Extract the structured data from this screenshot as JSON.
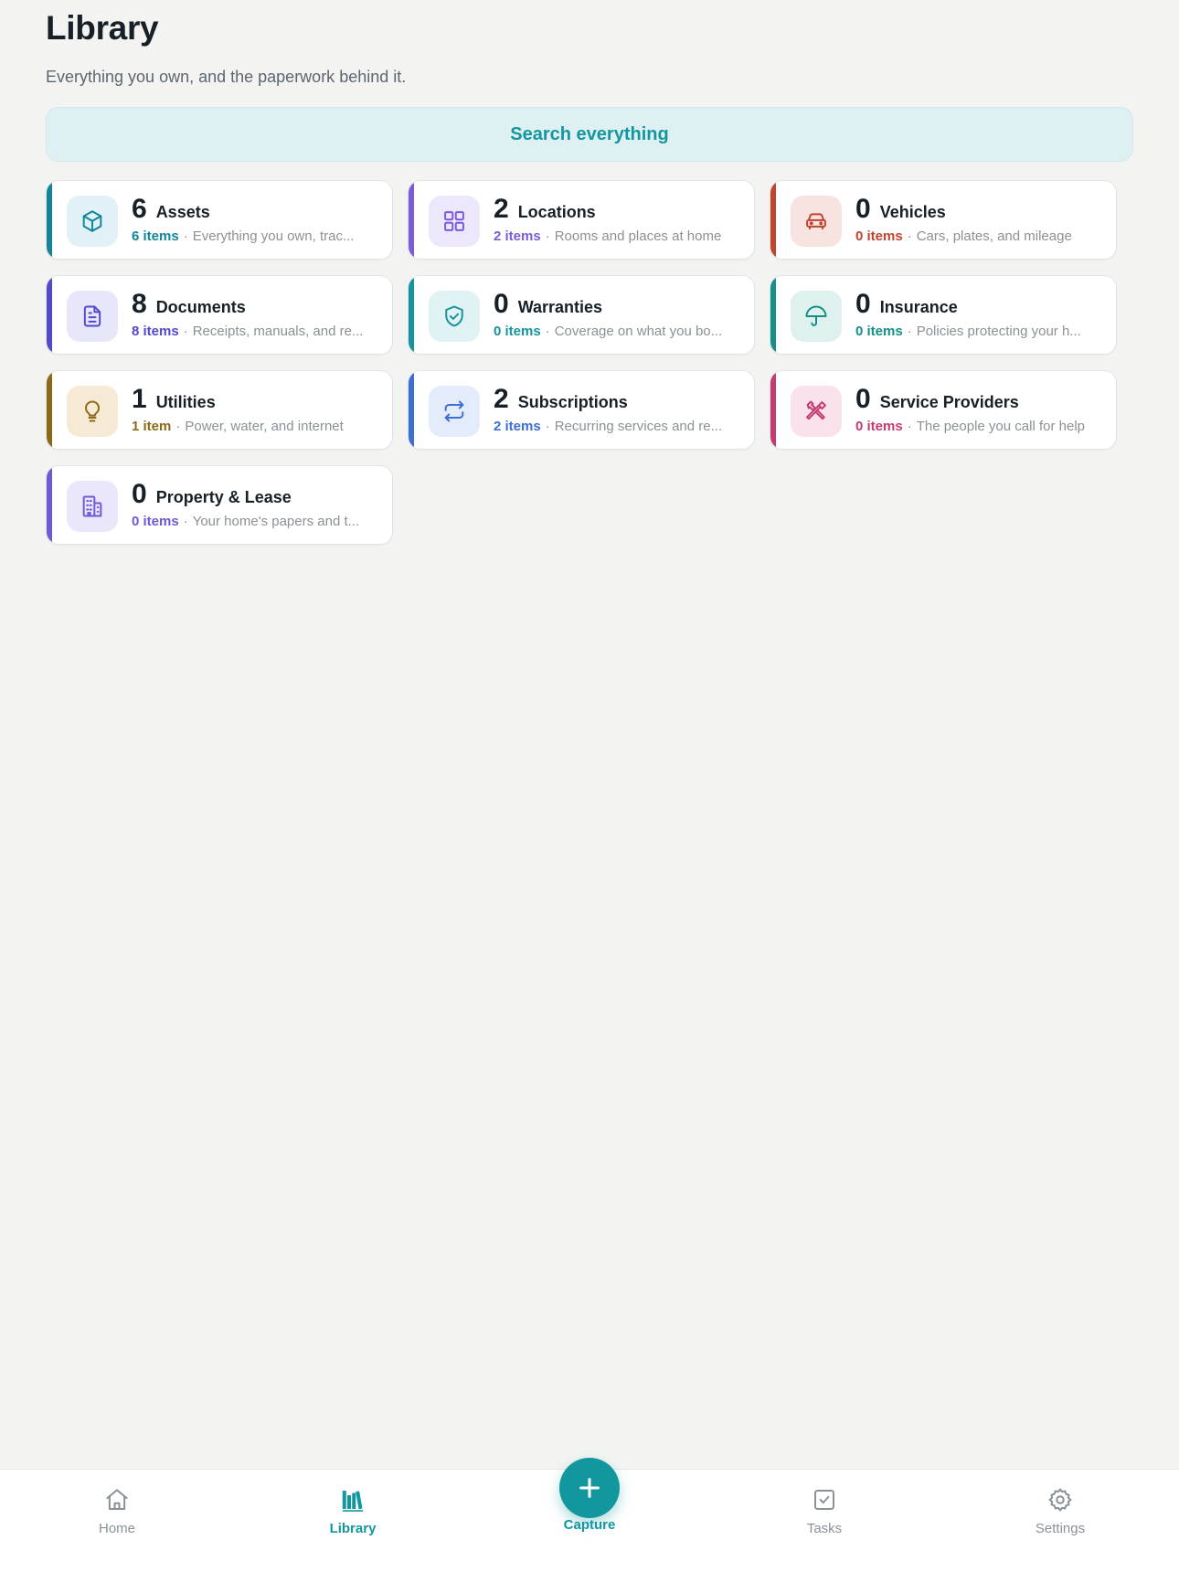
{
  "header": {
    "title": "Library",
    "subtitle": "Everything you own, and the paperwork behind it."
  },
  "search": {
    "label": "Search everything"
  },
  "categories": [
    {
      "count": "6",
      "title": "Assets",
      "items": "6 items",
      "desc": "Everything you own, trac...",
      "color": "#13859a",
      "bg": "#e1f1f6",
      "icon": "cube-icon"
    },
    {
      "count": "2",
      "title": "Locations",
      "items": "2 items",
      "desc": "Rooms and places at home",
      "color": "#7a5bd9",
      "bg": "#ece7fb",
      "icon": "grid-icon"
    },
    {
      "count": "0",
      "title": "Vehicles",
      "items": "0 items",
      "desc": "Cars, plates, and mileage",
      "color": "#c2432e",
      "bg": "#f7e4e0",
      "icon": "car-icon"
    },
    {
      "count": "8",
      "title": "Documents",
      "items": "8 items",
      "desc": "Receipts, manuals, and re...",
      "color": "#5448cf",
      "bg": "#e8e7fa",
      "icon": "document-icon"
    },
    {
      "count": "0",
      "title": "Warranties",
      "items": "0 items",
      "desc": "Coverage on what you bo...",
      "color": "#15949d",
      "bg": "#e0f2f4",
      "icon": "shield-check-icon"
    },
    {
      "count": "0",
      "title": "Insurance",
      "items": "0 items",
      "desc": "Policies protecting your h...",
      "color": "#168f88",
      "bg": "#dff1ef",
      "icon": "umbrella-icon"
    },
    {
      "count": "1",
      "title": "Utilities",
      "items": "1 item",
      "desc": "Power, water, and internet",
      "color": "#8a6a16",
      "bg": "#f7ead4",
      "icon": "lightbulb-icon"
    },
    {
      "count": "2",
      "title": "Subscriptions",
      "items": "2 items",
      "desc": "Recurring services and re...",
      "color": "#3c6ed8",
      "bg": "#e4ebfb",
      "icon": "repeat-icon"
    },
    {
      "count": "0",
      "title": "Service Providers",
      "items": "0 items",
      "desc": "The people you call for help",
      "color": "#c63a72",
      "bg": "#f9e2ec",
      "icon": "tools-icon"
    },
    {
      "count": "0",
      "title": "Property & Lease",
      "items": "0 items",
      "desc": "Your home's papers and t...",
      "color": "#7158d6",
      "bg": "#ebe7fb",
      "icon": "building-icon"
    }
  ],
  "tabbar": {
    "home": "Home",
    "library": "Library",
    "capture": "Capture",
    "tasks": "Tasks",
    "settings": "Settings",
    "active_color": "#13979f",
    "inactive_color": "#8a9197"
  }
}
